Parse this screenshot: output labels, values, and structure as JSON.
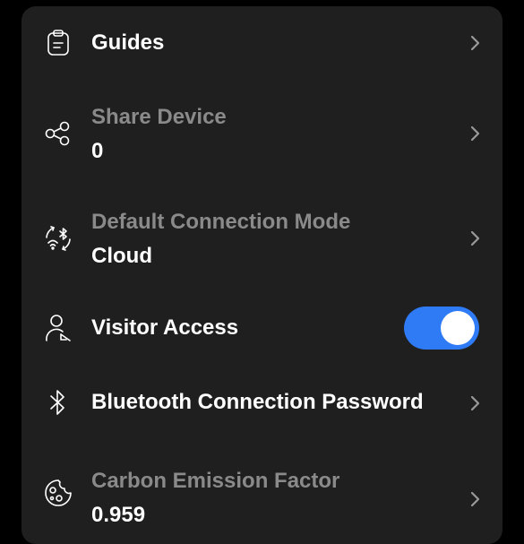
{
  "settings": {
    "guides": {
      "label": "Guides",
      "icon": "clipboard-icon"
    },
    "share_device": {
      "label": "Share Device",
      "value": "0",
      "icon": "share-icon"
    },
    "connection_mode": {
      "label": "Default Connection Mode",
      "value": "Cloud",
      "icon": "wifi-bluetooth-switch-icon"
    },
    "visitor_access": {
      "label": "Visitor Access",
      "enabled": true,
      "icon": "visitor-icon"
    },
    "bluetooth_password": {
      "label": "Bluetooth Connection Password",
      "icon": "bluetooth-icon"
    },
    "carbon_factor": {
      "label": "Carbon Emission Factor",
      "value": "0.959",
      "icon": "carbon-icon"
    }
  },
  "colors": {
    "background": "#000000",
    "card": "#1f1f1f",
    "toggle_on": "#2f7bf6",
    "secondary_text": "#8a8a8a"
  }
}
